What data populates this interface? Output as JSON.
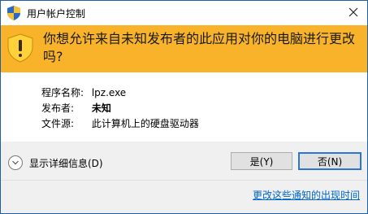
{
  "window": {
    "title": "用户帐户控制",
    "close_icon": "close-icon",
    "title_icon": "uac-shield-icon"
  },
  "header": {
    "question": "你想允许来自未知发布者的此应用对你的电脑进行更改吗?",
    "shield_icon": "warning-shield-icon",
    "background": "#f8b32a"
  },
  "info": {
    "program_label": "程序名称:",
    "program_value": "lpz.exe",
    "publisher_label": "发布者:",
    "publisher_value": "未知",
    "source_label": "文件源:",
    "source_value": "此计算机上的硬盘驱动器"
  },
  "footer": {
    "details_label": "显示详细信息(D)",
    "yes_label": "是(Y)",
    "no_label": "否(N)",
    "link_label": "更改这些通知的出现时间",
    "link_color": "#0066cc",
    "default_button_border": "#2b76d2"
  }
}
